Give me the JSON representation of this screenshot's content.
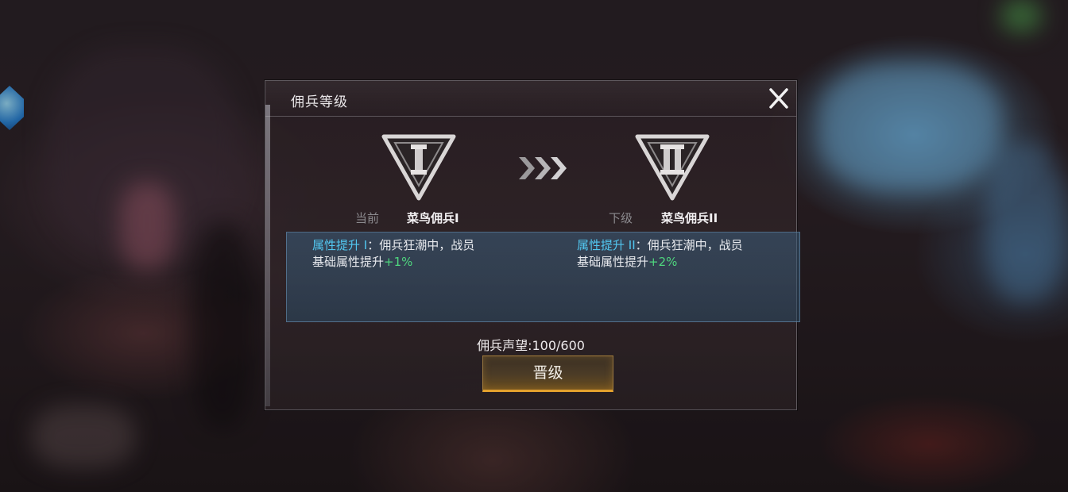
{
  "dialog": {
    "title": "佣兵等级",
    "close_label": "X"
  },
  "current": {
    "label": "当前",
    "name": "菜鸟佣兵I",
    "emblem_numeral": "I",
    "desc_prefix": "属性提升 I",
    "desc_line1_rest": "：佣兵狂潮中，战员",
    "desc_line2_text": "基础属性提升",
    "desc_bonus": "+1%"
  },
  "next": {
    "label": "下级",
    "name": "菜鸟佣兵II",
    "emblem_numeral": "II",
    "desc_prefix": "属性提升 II",
    "desc_line1_rest": "：佣兵狂潮中，战员",
    "desc_line2_text": "基础属性提升",
    "desc_bonus": "+2%"
  },
  "reputation": "佣兵声望:100/600",
  "upgrade_button": "晋级",
  "colors": {
    "highlight": "#52c7f0",
    "bonus": "#4fd67e",
    "button_accent": "#e3a12d"
  }
}
